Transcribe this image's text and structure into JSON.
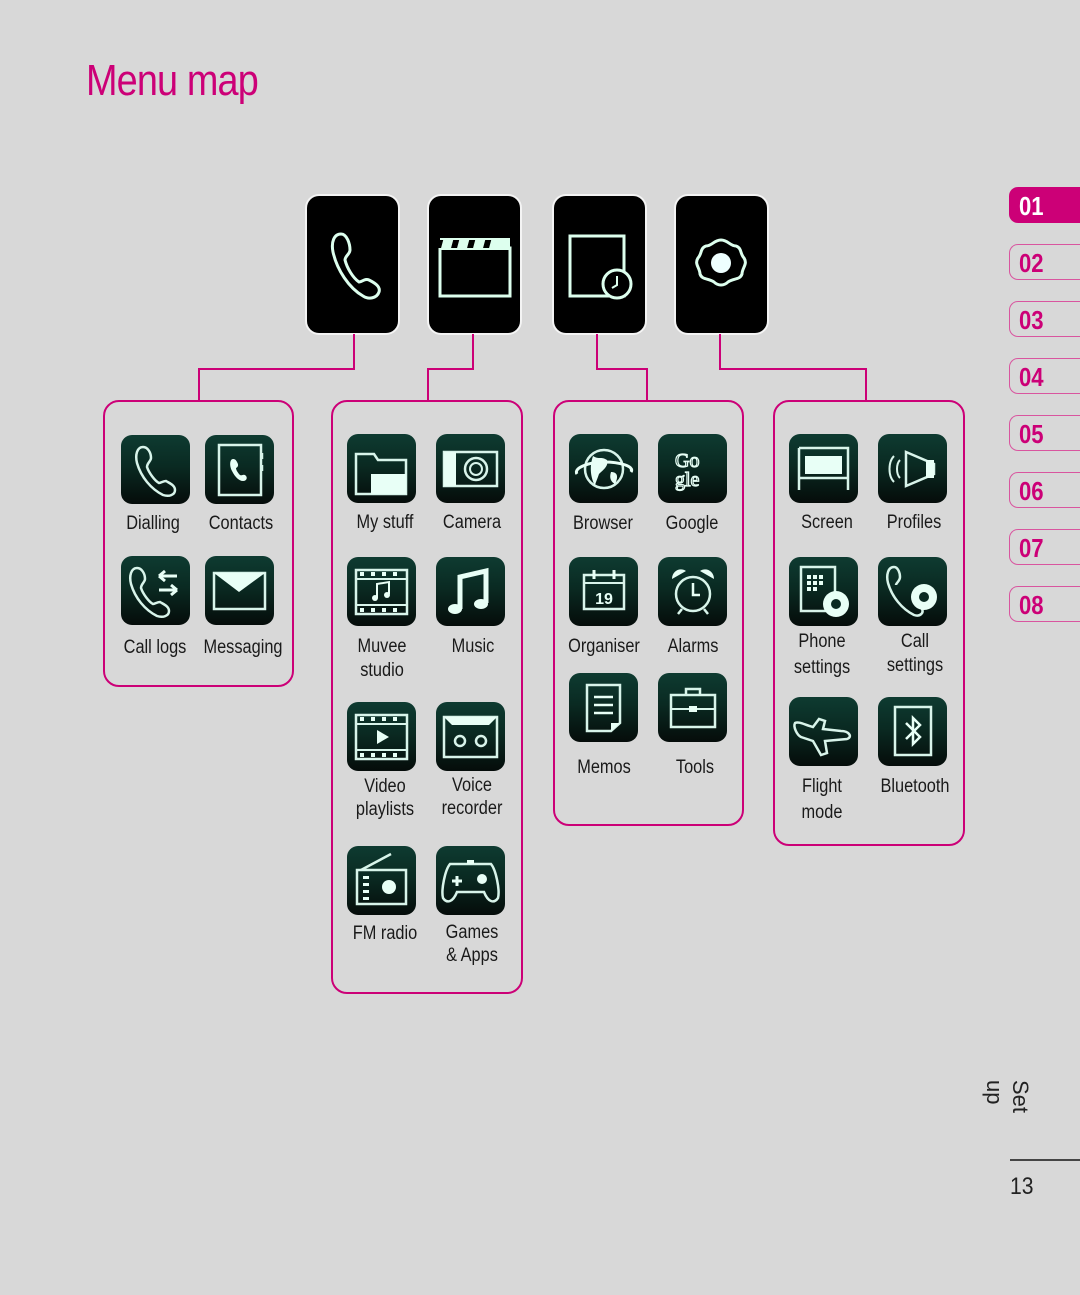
{
  "page_title": "Menu map",
  "top_menu": [
    {
      "name": "phone",
      "icon": "phone-icon"
    },
    {
      "name": "multimedia",
      "icon": "clapperboard-icon"
    },
    {
      "name": "utilities",
      "icon": "organiser-clock-icon"
    },
    {
      "name": "settings",
      "icon": "gear-icon"
    }
  ],
  "groups": [
    {
      "items": [
        {
          "label": "Dialling",
          "icon": "phone-icon"
        },
        {
          "label": "Contacts",
          "icon": "contacts-book-icon"
        },
        {
          "label": "Call logs",
          "icon": "call-log-icon"
        },
        {
          "label": "Messaging",
          "icon": "envelope-icon"
        }
      ]
    },
    {
      "items": [
        {
          "label": "My stuff",
          "icon": "folder-icon"
        },
        {
          "label": "Camera",
          "icon": "camera-icon"
        },
        {
          "label": "Muvee studio",
          "line1": "Muvee",
          "line2": "studio",
          "icon": "film-music-icon"
        },
        {
          "label": "Music",
          "icon": "music-note-icon"
        },
        {
          "label": "Video playlists",
          "line1": "Video",
          "line2": "playlists",
          "icon": "video-play-icon"
        },
        {
          "label": "Voice recorder",
          "line1": "Voice",
          "line2": "recorder",
          "icon": "cassette-icon"
        },
        {
          "label": "FM radio",
          "icon": "radio-icon"
        },
        {
          "label": "Games & Apps",
          "line1": "Games",
          "line2": "& Apps",
          "icon": "gamepad-icon"
        }
      ]
    },
    {
      "items": [
        {
          "label": "Browser",
          "icon": "globe-icon"
        },
        {
          "label": "Google",
          "icon": "google-icon"
        },
        {
          "label": "Organiser",
          "icon": "calendar-icon",
          "calendar_day": "19"
        },
        {
          "label": "Alarms",
          "icon": "alarm-clock-icon"
        },
        {
          "label": "Memos",
          "icon": "memo-icon"
        },
        {
          "label": "Tools",
          "icon": "toolbox-icon"
        }
      ]
    },
    {
      "items": [
        {
          "label": "Screen",
          "icon": "screen-icon"
        },
        {
          "label": "Profiles",
          "icon": "speaker-icon"
        },
        {
          "label": "Phone settings",
          "line1": "Phone",
          "line2": "settings",
          "icon": "phone-settings-icon"
        },
        {
          "label": "Call settings",
          "line1": "Call",
          "line2": "settings",
          "icon": "call-settings-icon"
        },
        {
          "label": "Flight mode",
          "line1": "Flight",
          "line2": "mode",
          "icon": "airplane-icon"
        },
        {
          "label": "Bluetooth",
          "icon": "bluetooth-icon"
        }
      ]
    }
  ],
  "chapter_tabs": [
    {
      "label": "01",
      "active": true
    },
    {
      "label": "02",
      "active": false
    },
    {
      "label": "03",
      "active": false
    },
    {
      "label": "04",
      "active": false
    },
    {
      "label": "05",
      "active": false
    },
    {
      "label": "06",
      "active": false
    },
    {
      "label": "07",
      "active": false
    },
    {
      "label": "08",
      "active": false
    }
  ],
  "section_name": "Set up",
  "page_number": "13",
  "colors": {
    "accent": "#cc0077",
    "background": "#d8d8d8",
    "icon_top": "#0e3b31",
    "icon_bottom": "#050c0a"
  }
}
